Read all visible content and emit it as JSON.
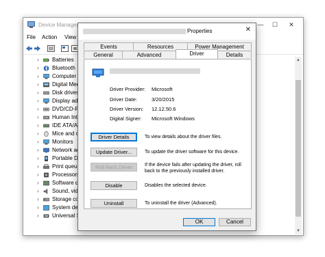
{
  "device_manager": {
    "title": "Device Manager",
    "menu": [
      "File",
      "Action",
      "View"
    ],
    "window_controls": {
      "minimize": "—",
      "maximize": "☐",
      "close": "✕"
    },
    "toolbar_icons": [
      "back-arrow-icon",
      "forward-arrow-icon",
      "show-hide-icon",
      "properties-icon",
      "help-icon"
    ],
    "tree": [
      {
        "label": "Batteries",
        "icon": "battery-icon"
      },
      {
        "label": "Bluetooth",
        "icon": "bluetooth-icon"
      },
      {
        "label": "Computer",
        "icon": "computer-icon"
      },
      {
        "label": "Digital Med",
        "icon": "digital-media-icon"
      },
      {
        "label": "Disk drives",
        "icon": "disk-drive-icon"
      },
      {
        "label": "Display ada",
        "icon": "display-adapter-icon"
      },
      {
        "label": "DVD/CD-RO",
        "icon": "dvd-drive-icon"
      },
      {
        "label": "Human Inte",
        "icon": "hid-icon"
      },
      {
        "label": "IDE ATA/AT",
        "icon": "ide-controller-icon"
      },
      {
        "label": "Mice and ot",
        "icon": "mouse-icon"
      },
      {
        "label": "Monitors",
        "icon": "monitor-icon"
      },
      {
        "label": "Network ad",
        "icon": "network-adapter-icon"
      },
      {
        "label": "Portable De",
        "icon": "portable-device-icon"
      },
      {
        "label": "Print queue",
        "icon": "printer-icon"
      },
      {
        "label": "Processors",
        "icon": "processor-icon"
      },
      {
        "label": "Software de",
        "icon": "software-device-icon"
      },
      {
        "label": "Sound, vide",
        "icon": "sound-icon"
      },
      {
        "label": "Storage con",
        "icon": "storage-controller-icon"
      },
      {
        "label": "System dev",
        "icon": "system-device-icon"
      },
      {
        "label": "Universal Se",
        "icon": "usb-controller-icon"
      }
    ]
  },
  "dialog": {
    "title": "Properties",
    "close_glyph": "✕",
    "tabs_row1": [
      "Events",
      "Resources",
      "Power Management"
    ],
    "tabs_row2": [
      "General",
      "Advanced",
      "Driver",
      "Details"
    ],
    "active_tab": "Driver",
    "driver_info": [
      {
        "label": "Driver Provider:",
        "value": "Microsoft"
      },
      {
        "label": "Driver Date:",
        "value": "3/20/2015"
      },
      {
        "label": "Driver Version:",
        "value": "12.12.50.6"
      },
      {
        "label": "Digital Signer:",
        "value": "Microsoft Windows"
      }
    ],
    "actions": [
      {
        "button": "Driver Details",
        "description": "To view details about the driver files."
      },
      {
        "button": "Update Driver...",
        "description": "To update the driver software for this device."
      },
      {
        "button": "Roll Back Driver",
        "description": "If the device fails after updating the driver, roll back to the previously installed driver."
      },
      {
        "button": "Disable",
        "description": "Disables the selected device."
      },
      {
        "button": "Uninstall",
        "description": "To uninstall the driver (Advanced)."
      }
    ],
    "ok_label": "OK",
    "cancel_label": "Cancel"
  }
}
